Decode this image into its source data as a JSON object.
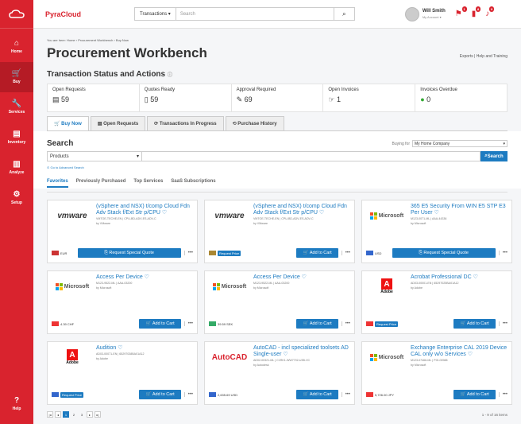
{
  "sidebar": {
    "items": [
      {
        "label": "Home",
        "icon": "home-icon"
      },
      {
        "label": "Buy",
        "icon": "cart-icon"
      },
      {
        "label": "Services",
        "icon": "wrench-icon"
      },
      {
        "label": "Inventory",
        "icon": "inventory-icon"
      },
      {
        "label": "Analyze",
        "icon": "chart-icon"
      },
      {
        "label": "Setup",
        "icon": "gear-icon"
      }
    ],
    "help": "Help"
  },
  "topbar": {
    "brand": "PyraCloud",
    "transactions": "Transactions ▾",
    "search_placeholder": "Search",
    "user_name": "Will Smith",
    "user_sub": "My Account ▾",
    "badges": [
      "1",
      "8",
      "9"
    ]
  },
  "breadcrumb": "You are here: Home › Procurement Workbench › Buy Now",
  "page_title": "Procurement Workbench",
  "exports": "Exports | Help and Training",
  "status_title": "Transaction Status and Actions",
  "status": [
    {
      "label": "Open Requests",
      "value": "59"
    },
    {
      "label": "Quotes Ready",
      "value": "59"
    },
    {
      "label": "Approval Required",
      "value": "69"
    },
    {
      "label": "Open Invoices",
      "value": "1"
    },
    {
      "label": "Invoices Overdue",
      "value": "0"
    }
  ],
  "tabs": [
    "Buy Now",
    "Open Requests",
    "Transactions In Progress",
    "Purchase History"
  ],
  "search": {
    "title": "Search",
    "buying_for_label": "Buying for",
    "buying_for": "My Home Company",
    "category": "Products",
    "button": "Search",
    "advanced": "Go to Advanced Search"
  },
  "subtabs": [
    "Favorites",
    "Previously Purchased",
    "Top Services",
    "SaaS Subscriptions"
  ],
  "products": [
    {
      "vendor": "vmware",
      "name": "(vSphere and NSX) t/comp Cloud Fdn Adv Stack f/Ext Str p/CPU ♡",
      "sku": "VMTOE-TECHE-EN | CPU-BD-ADV-ES-ADV-C",
      "by": "by VMware",
      "price": "EUR",
      "button": "Request Special Quote",
      "rp": false
    },
    {
      "vendor": "vmware",
      "name": "(vSphere and NSX) t/comp Cloud Fdn Adv Stack f/Ext Str p/CPU ♡",
      "sku": "VMTOE-TECHE-EN | CPU-BD-ADV-ES-ADV-C",
      "by": "by VMware",
      "price": "Request Price",
      "button": "Add to Cart",
      "rp": true
    },
    {
      "vendor": "Microsoft",
      "name": "365 E5 Security From WIN E5 STP E3 Per User ♡",
      "sku": "M123-0071-ML | AAA-44336",
      "by": "by Microsoft",
      "price": "USD",
      "button": "Request Special Quote",
      "rp": false
    },
    {
      "vendor": "Microsoft",
      "name": "Access Per Device ♡",
      "sku": "M123-9522-ML | AAA-03200",
      "by": "by Microsoft",
      "price": "4.39 CHF",
      "button": "Add to Cart",
      "rp": false
    },
    {
      "vendor": "Microsoft",
      "name": "Access Per Device ♡",
      "sku": "M123-9522-ML | AAA-03200",
      "by": "by Microsoft",
      "price": "39.59 SEK",
      "button": "Add to Cart",
      "rp": false
    },
    {
      "vendor": "Adobe",
      "name": "Acrobat Professional DC ♡",
      "sku": "AD03-00001-EN | 65297025BA01A12",
      "by": "by Adobe",
      "price": "Request Price",
      "button": "Add to Cart",
      "rp": true
    },
    {
      "vendor": "Adobe",
      "name": "Audition ♡",
      "sku": "AD03-00071-EN | 65297038BA01A12",
      "by": "by Adobe",
      "price": "Request Price",
      "button": "Add to Cart",
      "rp": true
    },
    {
      "vendor": "AutoCAD",
      "name": "AutoCAD - incl specialized toolsets AD Single-user ♡",
      "sku": "AD02-00321-ML | C1RK1-WW7702-U3B-VC",
      "by": "by Autodesk",
      "price": "2,635.69 USD",
      "button": "Add to Cart",
      "rp": false
    },
    {
      "vendor": "Microsoft",
      "name": "Exchange Enterprise CAL 2019 Device CAL only w/o Services ♡",
      "sku": "M123-07466-ML | PGI-00988",
      "by": "by Microsoft",
      "price": "5,726.00 JPY",
      "button": "Add to Cart",
      "rp": false
    }
  ],
  "pager": {
    "pages": [
      "1",
      "2",
      "3"
    ],
    "summary": "1 - 9 of 16 items"
  },
  "colors": {
    "brand": "#d9232e",
    "accent": "#1d7bc1"
  }
}
